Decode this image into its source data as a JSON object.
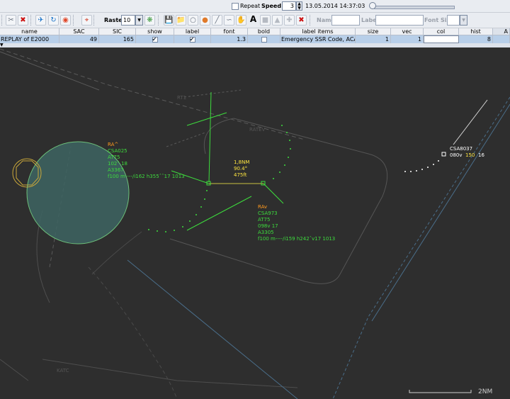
{
  "topbar": {
    "repeat_label": "Repeat",
    "repeat_checked": false,
    "speed_label": "Speed:",
    "speed_value": "3",
    "timestamp": "13.05.2014 14:37:03",
    "slider_value": 0
  },
  "toolbar": {
    "raster_label": "Raster",
    "raster_checked": false,
    "raster_value": "10",
    "name_label": "Name",
    "label_label": "Label",
    "fontsize_label": "Font Size"
  },
  "table": {
    "columns": [
      "name",
      "SAC",
      "SIC",
      "show",
      "label",
      "font",
      "bold",
      "label items",
      "size",
      "vec",
      "col",
      "hist",
      "A"
    ],
    "row": {
      "name": "REPLAY of E2000",
      "sac": "49",
      "sic": "165",
      "show": true,
      "label": true,
      "font": "1.3",
      "bold": false,
      "label_items": "Emergency SSR Code, ACA...",
      "size": "1",
      "vec": "1",
      "col": "",
      "hist": "8"
    }
  },
  "radar": {
    "sector_labels": [
      "RT1",
      "RATEV",
      "KATC"
    ],
    "track_ra_up": [
      "RA^",
      "CSA025",
      "AT75",
      "102ˆ  18",
      "A3367",
      "f100 m----/i162 h355ˆˆ17 1013"
    ],
    "track_ra_down": [
      "RAv",
      "CSA973",
      "AT75",
      "098v  17",
      "A3305",
      "f100 m----/i159 h242ˆv17 1013"
    ],
    "measure": [
      "1,8NM",
      "90.4°",
      "475ft"
    ],
    "track_csa8037": {
      "callsign": "CSA8037",
      "level": "080v",
      "cfl": "150",
      "speed": "16"
    },
    "scale_label": "2NM"
  },
  "colors": {
    "background": "#2e2e2e",
    "track_green": "#3ddc3d",
    "alert_orange": "#ff9a1e",
    "measure_yellow": "#ffe640",
    "selected_row": "#b8cfe9"
  }
}
